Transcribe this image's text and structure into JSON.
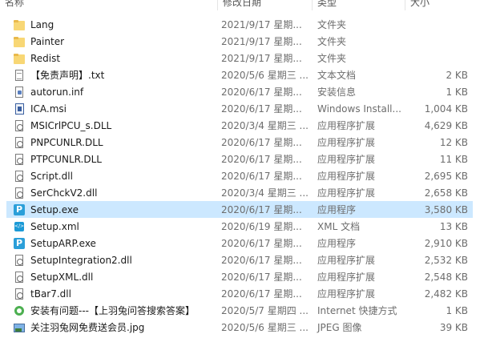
{
  "columns": {
    "name": "名称",
    "date": "修改日期",
    "type": "类型",
    "size": "大小"
  },
  "files": [
    {
      "name": "Lang",
      "date": "2021/9/17 星期...",
      "type": "文件夹",
      "size": "",
      "icon": "folder-icon",
      "selected": false
    },
    {
      "name": "Painter",
      "date": "2021/9/17 星期...",
      "type": "文件夹",
      "size": "",
      "icon": "folder-icon",
      "selected": false
    },
    {
      "name": "Redist",
      "date": "2021/9/17 星期...",
      "type": "文件夹",
      "size": "",
      "icon": "folder-icon",
      "selected": false
    },
    {
      "name": "【免责声明】.txt",
      "date": "2020/5/6 星期三 ...",
      "type": "文本文档",
      "size": "2 KB",
      "icon": "text-document-icon",
      "selected": false
    },
    {
      "name": "autorun.inf",
      "date": "2020/6/17 星期...",
      "type": "安装信息",
      "size": "1 KB",
      "icon": "setup-info-icon",
      "selected": false
    },
    {
      "name": "ICA.msi",
      "date": "2020/6/17 星期...",
      "type": "Windows Install...",
      "size": "1,004 KB",
      "icon": "installer-package-icon",
      "selected": false
    },
    {
      "name": "MSICrlPCU_s.DLL",
      "date": "2020/3/4 星期三 ...",
      "type": "应用程序扩展",
      "size": "4,629 KB",
      "icon": "dll-icon",
      "selected": false
    },
    {
      "name": "PNPCUNLR.DLL",
      "date": "2020/6/17 星期...",
      "type": "应用程序扩展",
      "size": "12 KB",
      "icon": "dll-icon",
      "selected": false
    },
    {
      "name": "PTPCUNLR.DLL",
      "date": "2020/6/17 星期...",
      "type": "应用程序扩展",
      "size": "11 KB",
      "icon": "dll-icon",
      "selected": false
    },
    {
      "name": "Script.dll",
      "date": "2020/6/17 星期...",
      "type": "应用程序扩展",
      "size": "2,695 KB",
      "icon": "dll-icon",
      "selected": false
    },
    {
      "name": "SerChckV2.dll",
      "date": "2020/3/4 星期三 ...",
      "type": "应用程序扩展",
      "size": "2,658 KB",
      "icon": "dll-icon",
      "selected": false
    },
    {
      "name": "Setup.exe",
      "date": "2020/6/17 星期...",
      "type": "应用程序",
      "size": "3,580 KB",
      "icon": "painter-app-icon",
      "selected": true
    },
    {
      "name": "Setup.xml",
      "date": "2020/6/19 星期...",
      "type": "XML 文档",
      "size": "13 KB",
      "icon": "xml-document-icon",
      "selected": false
    },
    {
      "name": "SetupARP.exe",
      "date": "2020/6/17 星期...",
      "type": "应用程序",
      "size": "2,910 KB",
      "icon": "painter-app-icon",
      "selected": false
    },
    {
      "name": "SetupIntegration2.dll",
      "date": "2020/6/17 星期...",
      "type": "应用程序扩展",
      "size": "2,532 KB",
      "icon": "dll-icon",
      "selected": false
    },
    {
      "name": "SetupXML.dll",
      "date": "2020/6/17 星期...",
      "type": "应用程序扩展",
      "size": "2,548 KB",
      "icon": "dll-icon",
      "selected": false
    },
    {
      "name": "tBar7.dll",
      "date": "2020/6/17 星期...",
      "type": "应用程序扩展",
      "size": "2,482 KB",
      "icon": "dll-icon",
      "selected": false
    },
    {
      "name": "安装有问题---【上羽兔问答搜索答案】",
      "date": "2020/5/7 星期四 ...",
      "type": "Internet 快捷方式",
      "size": "1 KB",
      "icon": "internet-shortcut-icon",
      "selected": false
    },
    {
      "name": "关注羽兔网免费送会员.jpg",
      "date": "2020/5/6 星期三 ...",
      "type": "JPEG 图像",
      "size": "39 KB",
      "icon": "jpeg-image-icon",
      "selected": false
    }
  ],
  "colors": {
    "selected_row": "#cce8ff",
    "folder": "#f8d775",
    "exe_icon": "#2b9fd9"
  }
}
